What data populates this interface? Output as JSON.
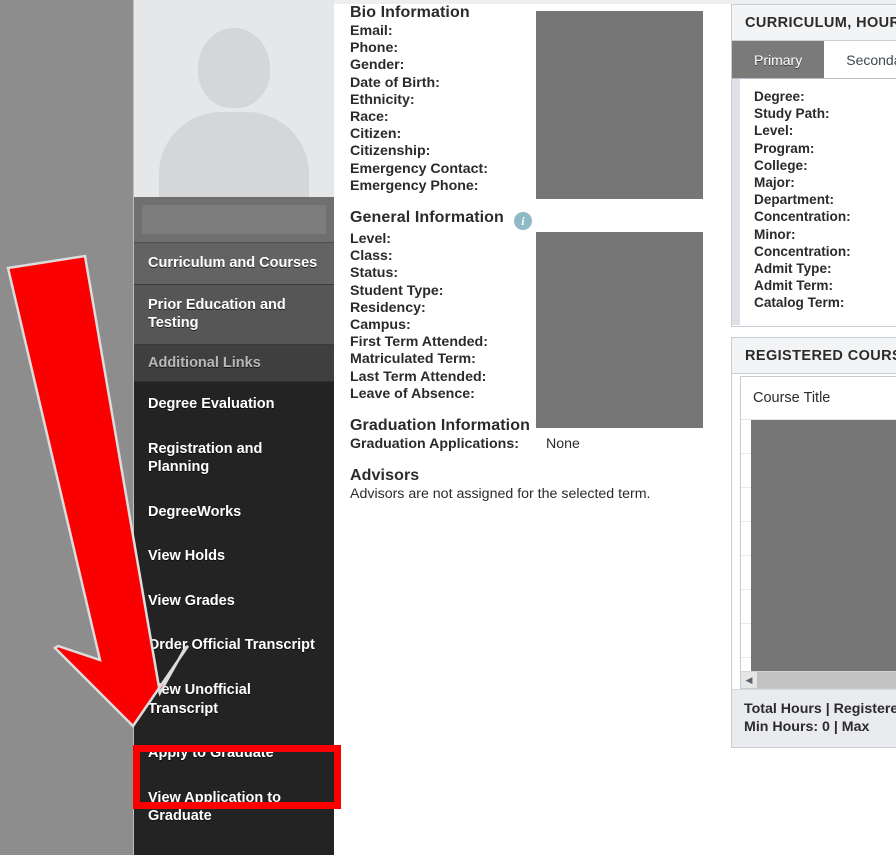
{
  "sidebar": {
    "avatar_alt": "student-photo-placeholder",
    "items": [
      {
        "label": "Curriculum and Courses",
        "style": "lvl-a"
      },
      {
        "label": "Prior Education and Testing",
        "style": "lvl-b"
      },
      {
        "label": "Additional Links",
        "style": "section"
      },
      {
        "label": "Degree Evaluation",
        "style": "dark"
      },
      {
        "label": "Registration and Planning",
        "style": "dark"
      },
      {
        "label": "DegreeWorks",
        "style": "dark"
      },
      {
        "label": "View Holds",
        "style": "dark"
      },
      {
        "label": "View Grades",
        "style": "dark"
      },
      {
        "label": "Order Official Transcript",
        "style": "dark"
      },
      {
        "label": "View Unofficial Transcript",
        "style": "dark"
      },
      {
        "label": "Apply to Graduate",
        "style": "dark"
      },
      {
        "label": "View Application to Graduate",
        "style": "dark"
      }
    ]
  },
  "bio": {
    "title": "Bio Information",
    "fields": [
      "Email:",
      "Phone:",
      "Gender:",
      "Date of Birth:",
      "Ethnicity:",
      "Race:",
      "Citizen:",
      "Citizenship:",
      "Emergency Contact:",
      "Emergency Phone:"
    ]
  },
  "general": {
    "title": "General Information",
    "info_icon": "info-icon",
    "fields": [
      "Level:",
      "Class:",
      "Status:",
      "Student Type:",
      "Residency:",
      "Campus:",
      "First Term Attended:",
      "Matriculated Term:",
      "Last Term Attended:",
      "Leave of Absence:"
    ]
  },
  "graduation": {
    "title": "Graduation Information",
    "label": "Graduation Applications:",
    "value": "None"
  },
  "advisors": {
    "title": "Advisors",
    "message": "Advisors are not assigned for the selected term."
  },
  "curriculum_card": {
    "header": "CURRICULUM, HOURS",
    "tabs": [
      {
        "label": "Primary",
        "active": true
      },
      {
        "label": "Secondary",
        "active": false
      }
    ],
    "fields": [
      "Degree:",
      "Study Path:",
      "Level:",
      "Program:",
      "College:",
      "Major:",
      "Department:",
      "Concentration:",
      "Minor:",
      "Concentration:",
      "Admit Type:",
      "Admit Term:",
      "Catalog Term:"
    ]
  },
  "registered_card": {
    "header": "REGISTERED COURSES",
    "column_header": "Course Title",
    "scroll_left_icon": "chevron-left-icon",
    "total_hours_line": "Total Hours |  Registered",
    "min_hours_line": "Min Hours:  0  |  Max"
  },
  "annotation": {
    "arrow_color": "#fb0000",
    "highlight_color": "#fb0000",
    "arrow_name": "red-arrow-pointing-to-apply-to-graduate",
    "highlight_target": "Apply to Graduate"
  }
}
